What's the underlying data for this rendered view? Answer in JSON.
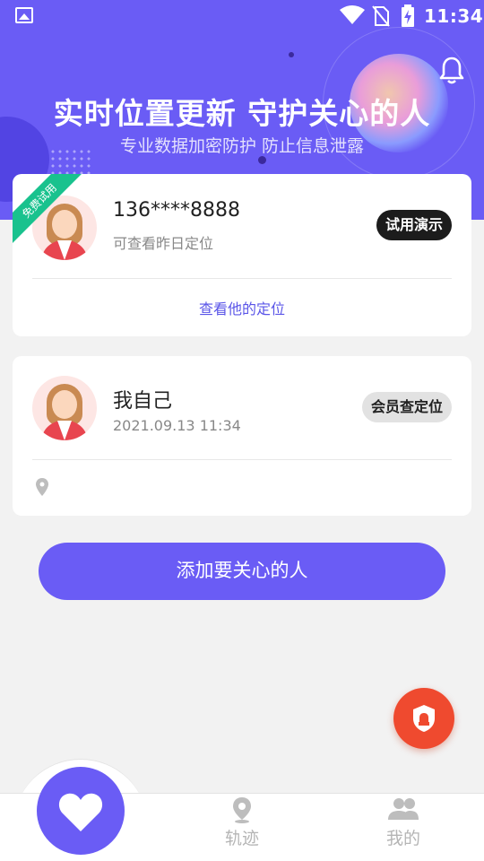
{
  "status_bar": {
    "time": "11:34"
  },
  "header": {
    "title": "实时位置更新 守护关心的人",
    "subtitle": "专业数据加密防护 防止信息泄露"
  },
  "cards": [
    {
      "ribbon": "免费试用",
      "name": "136****8888",
      "subtitle": "可查看昨日定位",
      "action_label": "试用演示",
      "link_label": "查看他的定位"
    },
    {
      "name": "我自己",
      "subtitle": "2021.09.13 11:34",
      "action_label": "会员查定位"
    }
  ],
  "add_button_label": "添加要关心的人",
  "tabs": [
    {
      "icon": "heart-icon"
    },
    {
      "label": "轨迹",
      "icon": "map-pin-icon"
    },
    {
      "label": "我的",
      "icon": "people-icon"
    }
  ],
  "colors": {
    "primary": "#6a5cf5",
    "ribbon": "#19c28e",
    "alarm": "#ef4a2f"
  }
}
